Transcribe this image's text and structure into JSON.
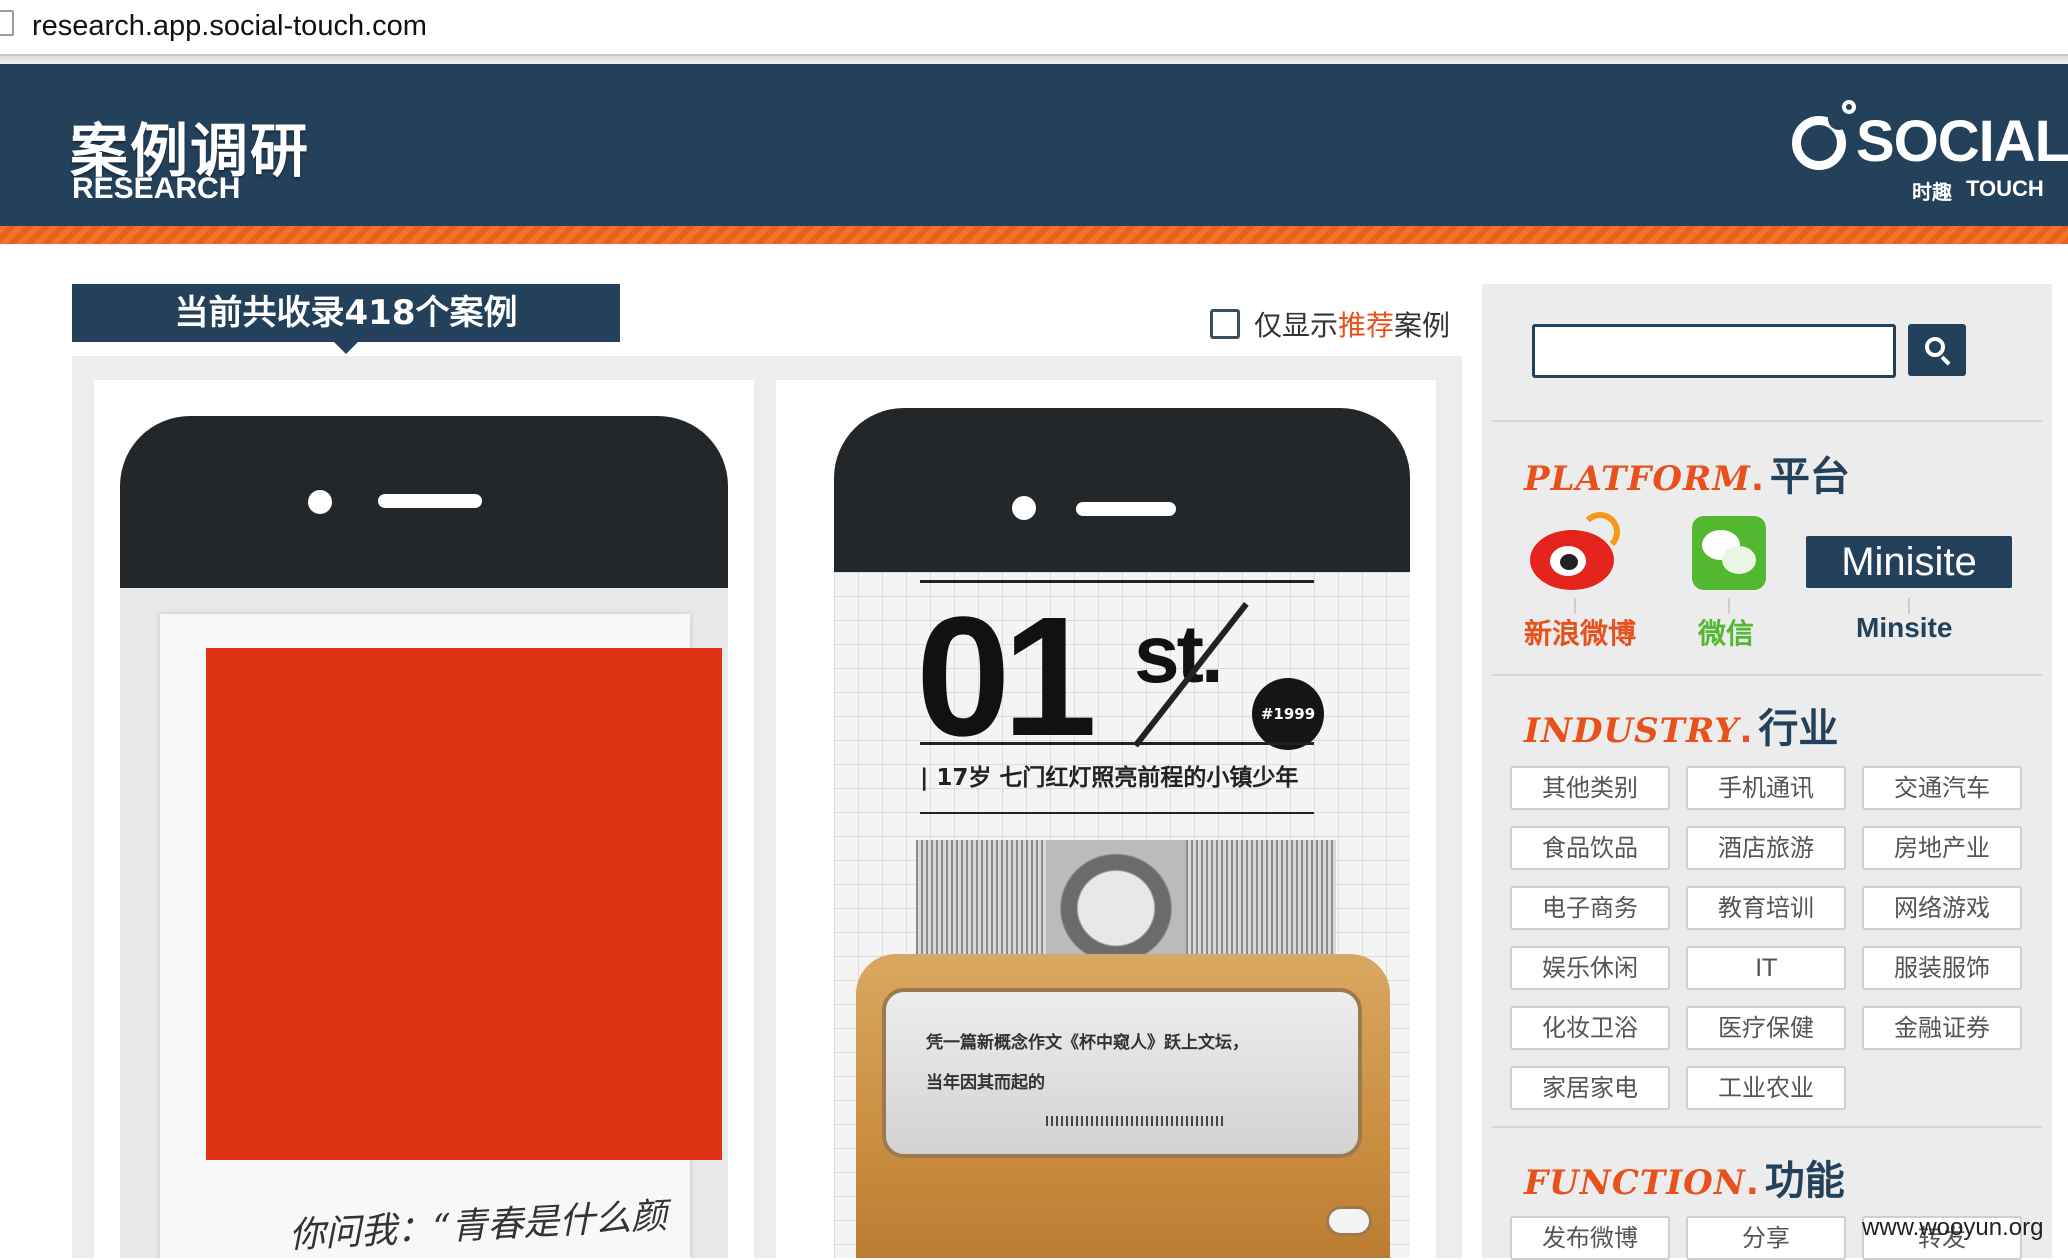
{
  "browser": {
    "url": "research.app.social-touch.com"
  },
  "header": {
    "title_cn": "案例调研",
    "title_en": "RESEARCH",
    "logo_word": "SOCIAL",
    "logo_sub_cn": "时趣",
    "logo_sub_en": "TOUCH"
  },
  "content": {
    "count_banner": "当前共收录418个案例",
    "filter": {
      "prefix": "仅显示",
      "highlight": "推荐",
      "suffix": "案例"
    },
    "cards": [
      {
        "caption": "你问我：“青春是什么颜色？”"
      },
      {
        "big_number": "01",
        "suffix": "st.",
        "badge": "#1999",
        "subtitle": "| 17岁 七门红灯照亮前程的小镇少年",
        "glass_line1": "凭一篇新概念作文《杯中窥人》跃上文坛，",
        "glass_line2": "当年因其而起的"
      }
    ]
  },
  "sidebar": {
    "search": {
      "placeholder": ""
    },
    "platform": {
      "title_en": "PLATFORM",
      "title_cn": "平台",
      "items": [
        {
          "label": "新浪微博",
          "color": "#e8501c"
        },
        {
          "label": "微信",
          "color": "#52b82f"
        },
        {
          "label": "Minsite",
          "badge": "Minisite",
          "color": "#23415a"
        }
      ]
    },
    "industry": {
      "title_en": "INDUSTRY",
      "title_cn": "行业",
      "tags": [
        "其他类别",
        "手机通讯",
        "交通汽车",
        "食品饮品",
        "酒店旅游",
        "房地产业",
        "电子商务",
        "教育培训",
        "网络游戏",
        "娱乐休闲",
        "IT",
        "服装服饰",
        "化妆卫浴",
        "医疗保健",
        "金融证券",
        "家居家电",
        "工业农业"
      ]
    },
    "function": {
      "title_en": "FUNCTION",
      "title_cn": "功能",
      "tags": [
        "发布微博",
        "分享",
        "转发"
      ]
    }
  },
  "watermark": "www.wooyun.org",
  "colors": {
    "header_bg": "#23415a",
    "accent": "#e8501c",
    "orange_band": "#f0742a"
  }
}
